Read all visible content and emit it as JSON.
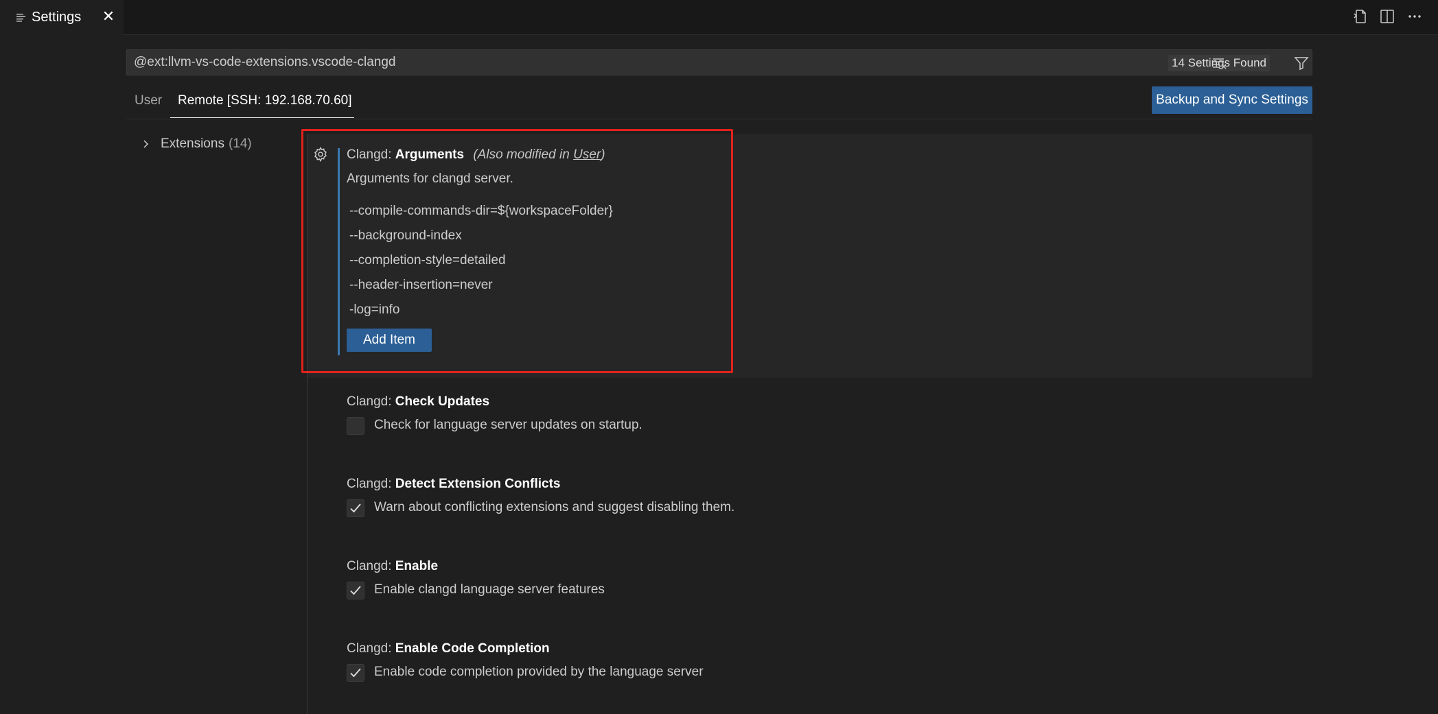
{
  "tab": {
    "label": "Settings",
    "close": "✕"
  },
  "search": {
    "value": "@ext:llvm-vs-code-extensions.vscode-clangd",
    "results_badge": "14 Settings Found"
  },
  "scope_tabs": {
    "user": "User",
    "remote": "Remote [SSH: 192.168.70.60]"
  },
  "sync_button": "Backup and Sync Settings",
  "toc": {
    "label": "Extensions",
    "count": "(14)"
  },
  "settings": {
    "arguments": {
      "category": "Clangd: ",
      "name": "Arguments",
      "modified_prefix": "(Also modified in ",
      "modified_link": "User",
      "modified_suffix": ")",
      "description": "Arguments for clangd server.",
      "items": [
        "--compile-commands-dir=${workspaceFolder}",
        "--background-index",
        "--completion-style=detailed",
        "--header-insertion=never",
        "-log=info"
      ],
      "add_button": "Add Item"
    },
    "check_updates": {
      "category": "Clangd: ",
      "name": "Check Updates",
      "label": "Check for language server updates on startup.",
      "checked": false
    },
    "detect_conflicts": {
      "category": "Clangd: ",
      "name": "Detect Extension Conflicts",
      "label": "Warn about conflicting extensions and suggest disabling them.",
      "checked": true
    },
    "enable": {
      "category": "Clangd: ",
      "name": "Enable",
      "label": "Enable clangd language server features",
      "checked": true
    },
    "enable_completion": {
      "category": "Clangd: ",
      "name": "Enable Code Completion",
      "label": "Enable code completion provided by the language server",
      "checked": true
    }
  },
  "colors": {
    "accent_button": "#2b5f96",
    "focus_bar": "#3b7ab3",
    "highlight": "#e3221b"
  },
  "icons": [
    "list-icon",
    "close-icon",
    "open-json-icon",
    "split-editor-icon",
    "more-icon",
    "clear-filter-icon",
    "filter-icon",
    "chevron-right-icon",
    "gear-icon",
    "checkmark-icon"
  ]
}
